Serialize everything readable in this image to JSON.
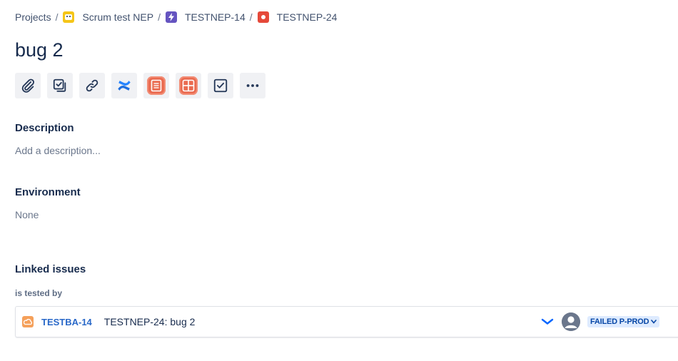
{
  "breadcrumb": {
    "projects": "Projects",
    "project": "Scrum test NEP",
    "epic": "TESTNEP-14",
    "issue": "TESTNEP-24",
    "separator": "/"
  },
  "issue": {
    "title": "bug 2"
  },
  "toolbar": {
    "buttons": [
      {
        "name": "attach",
        "icon": "paperclip-icon"
      },
      {
        "name": "child-issue",
        "icon": "subtask-icon"
      },
      {
        "name": "link-issue",
        "icon": "link-icon"
      },
      {
        "name": "confluence",
        "icon": "confluence-icon"
      },
      {
        "name": "app-report",
        "icon": "document-app-icon"
      },
      {
        "name": "app-grid",
        "icon": "grid-app-icon"
      },
      {
        "name": "checklist",
        "icon": "checkbox-icon"
      },
      {
        "name": "more",
        "icon": "more-icon"
      }
    ]
  },
  "description": {
    "heading": "Description",
    "placeholder": "Add a description..."
  },
  "environment": {
    "heading": "Environment",
    "value": "None"
  },
  "linked_issues": {
    "heading": "Linked issues",
    "relation": "is tested by",
    "items": [
      {
        "key": "TESTBA-14",
        "summary": "TESTNEP-24: bug 2",
        "status": "FAILED P-PROD",
        "priority": "low"
      }
    ]
  },
  "colors": {
    "text": "#172b4d",
    "link": "#2968c8",
    "status_bg": "#deebff",
    "status_text": "#0747a6",
    "button_bg": "#f0f1f4",
    "epic": "#6554c0",
    "bug": "#e5493a"
  }
}
